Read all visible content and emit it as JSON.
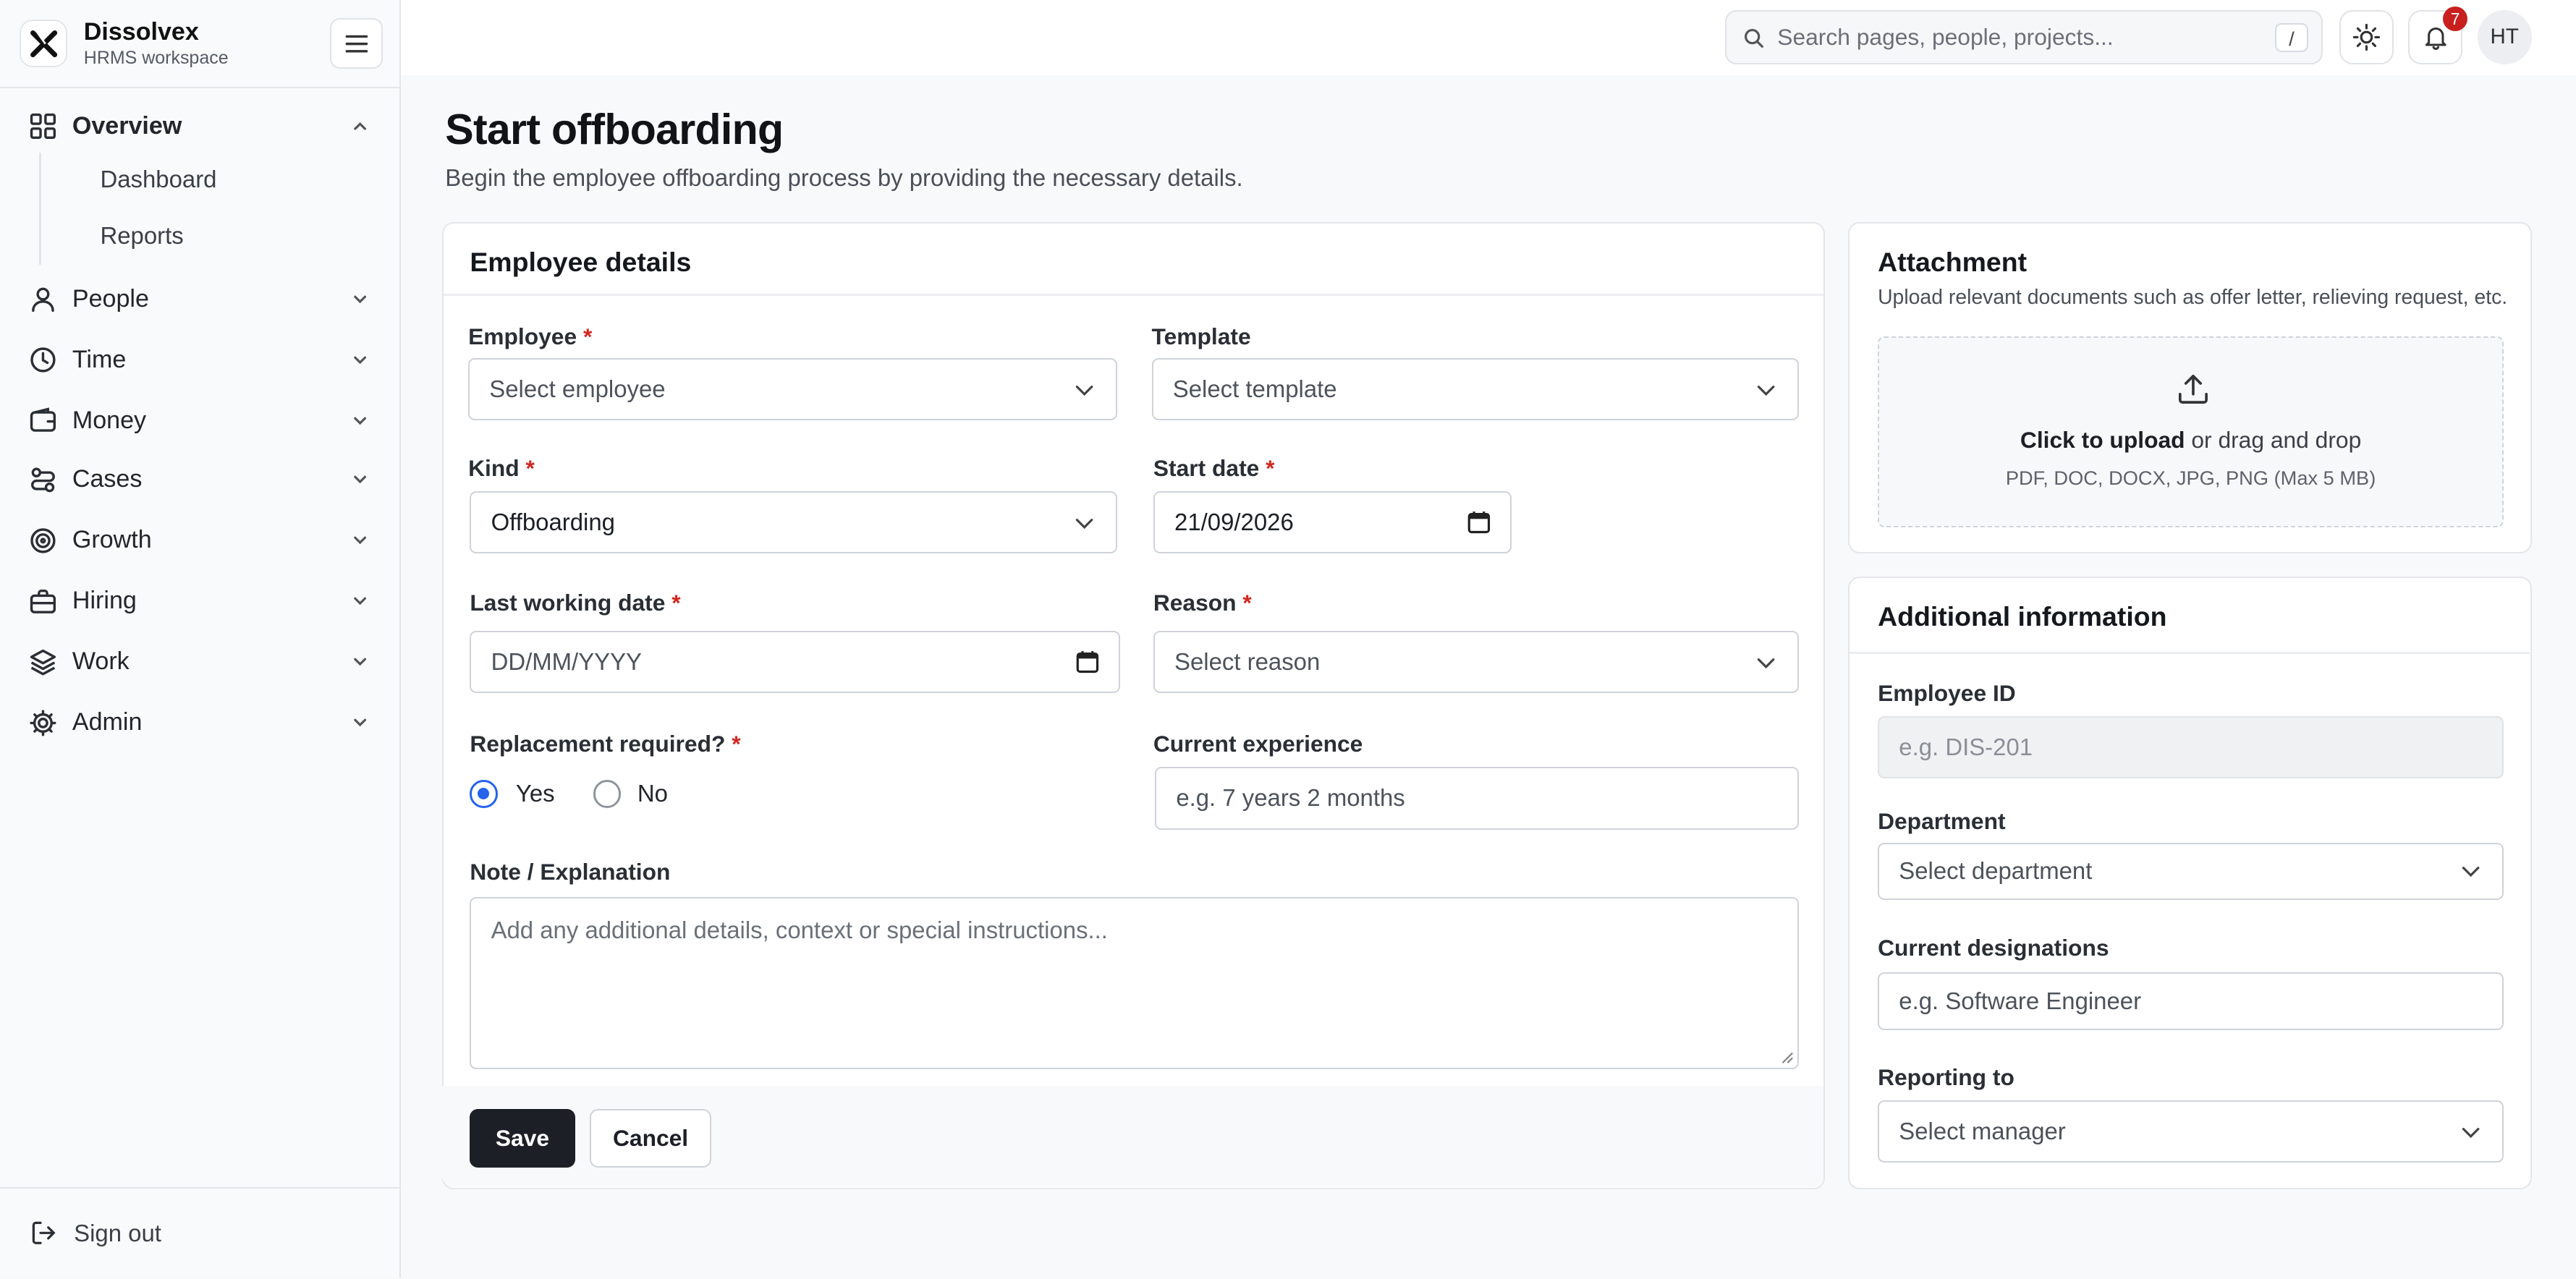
{
  "brand": {
    "name": "Dissolvex",
    "subtitle": "HRMS workspace"
  },
  "sidebar": {
    "items": [
      {
        "label": "Overview",
        "icon": "grid-icon",
        "expanded": true
      },
      {
        "label": "People",
        "icon": "user-icon"
      },
      {
        "label": "Time",
        "icon": "clock-icon"
      },
      {
        "label": "Money",
        "icon": "wallet-icon"
      },
      {
        "label": "Cases",
        "icon": "cases-icon"
      },
      {
        "label": "Growth",
        "icon": "target-icon"
      },
      {
        "label": "Hiring",
        "icon": "briefcase-icon"
      },
      {
        "label": "Work",
        "icon": "layers-icon"
      },
      {
        "label": "Admin",
        "icon": "gear-icon"
      }
    ],
    "overview_children": [
      "Dashboard",
      "Reports"
    ],
    "signout": "Sign out"
  },
  "topbar": {
    "search_placeholder": "Search pages, people, projects...",
    "search_shortcut": "/",
    "notification_count": "7",
    "avatar_initials": "HT"
  },
  "page": {
    "title": "Start offboarding",
    "subtitle": "Begin the employee offboarding process by providing the necessary details."
  },
  "employee_details": {
    "title": "Employee details",
    "employee": {
      "label": "Employee",
      "placeholder": "Select employee"
    },
    "template": {
      "label": "Template",
      "placeholder": "Select template"
    },
    "kind": {
      "label": "Kind",
      "value": "Offboarding"
    },
    "start_date": {
      "label": "Start date",
      "value": "21/09/2026"
    },
    "last_working_date": {
      "label": "Last working date",
      "placeholder": "DD/MM/YYYY"
    },
    "reason": {
      "label": "Reason",
      "placeholder": "Select reason"
    },
    "replacement": {
      "label": "Replacement required?",
      "yes": "Yes",
      "no": "No",
      "selected": "Yes"
    },
    "current_experience": {
      "label": "Current experience",
      "placeholder": "e.g. 7 years 2 months"
    },
    "note": {
      "label": "Note / Explanation",
      "placeholder": "Add any additional details, context or special instructions..."
    },
    "save": "Save",
    "cancel": "Cancel",
    "required_mark": "*"
  },
  "attachment": {
    "title": "Attachment",
    "subtitle": "Upload relevant documents such as offer letter, relieving request, etc.",
    "upload_strong": "Click to upload",
    "upload_rest": " or drag and drop",
    "formats": "PDF, DOC, DOCX, JPG, PNG (Max 5 MB)"
  },
  "additional": {
    "title": "Additional information",
    "employee_id": {
      "label": "Employee ID",
      "placeholder": "e.g. DIS-201"
    },
    "department": {
      "label": "Department",
      "placeholder": "Select department"
    },
    "designation": {
      "label": "Current designations",
      "placeholder": "e.g. Software Engineer"
    },
    "reporting_to": {
      "label": "Reporting to",
      "placeholder": "Select manager"
    }
  },
  "colors": {
    "accent": "#2563eb",
    "primary_button": "#1c1f26",
    "required": "#d2271f",
    "badge": "#c8201e"
  }
}
